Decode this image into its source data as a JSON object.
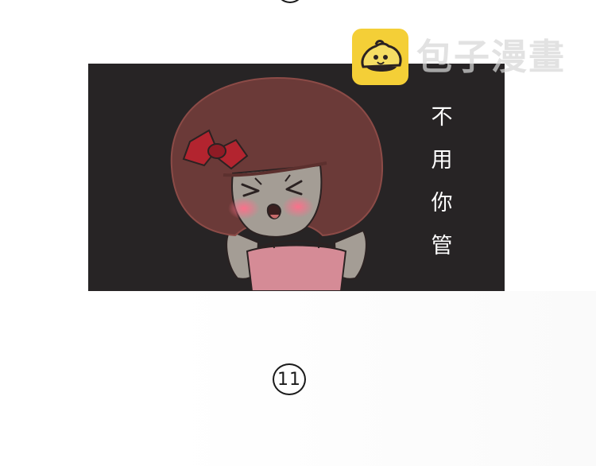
{
  "watermark": {
    "text": "包子漫畫",
    "logo": "bun-logo-icon"
  },
  "panel": {
    "caption": [
      "不",
      "用",
      "你",
      "管"
    ]
  },
  "page": {
    "number": "11"
  },
  "colors": {
    "panel_background": "#272425",
    "hair": "#6b3a38",
    "bow": "#b3242f",
    "logo_yellow": "#f4cf37",
    "cheeks": "#f07a8a"
  }
}
